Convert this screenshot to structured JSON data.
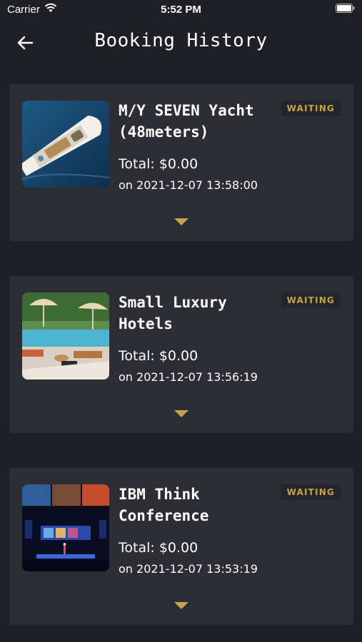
{
  "status_bar": {
    "carrier": "Carrier",
    "time": "5:52 PM"
  },
  "header": {
    "title": "Booking History",
    "back_icon": "arrow-left-icon"
  },
  "colors": {
    "background": "#1f2026",
    "card": "#2d2e35",
    "accent": "#c6a24a"
  },
  "bookings": [
    {
      "title": "M/Y SEVEN Yacht (48meters)",
      "status": "WAITING",
      "total": "Total: $0.00",
      "date": "on 2021-12-07 13:58:00",
      "image": "yacht-photo",
      "expand_icon": "caret-down-icon"
    },
    {
      "title": "Small Luxury Hotels",
      "status": "WAITING",
      "total": "Total: $0.00",
      "date": "on 2021-12-07 13:56:19",
      "image": "hotel-pool-photo",
      "expand_icon": "caret-down-icon"
    },
    {
      "title": "IBM Think Conference",
      "status": "WAITING",
      "total": "Total: $0.00",
      "date": "on 2021-12-07 13:53:19",
      "image": "conference-photo",
      "expand_icon": "caret-down-icon"
    }
  ]
}
